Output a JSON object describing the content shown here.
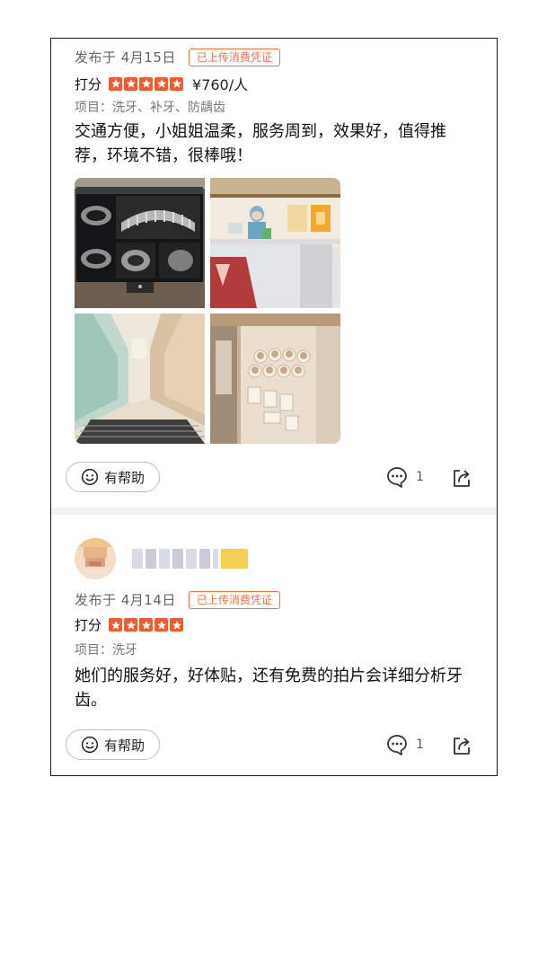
{
  "reviews": [
    {
      "date": "发布于 4月15日",
      "badge": "已上传消费凭证",
      "rating_label": "打分",
      "stars": 5,
      "price": "¥760/人",
      "project": "项目：洗牙、补牙、防龋齿",
      "text": "交通方便，小姐姐温柔，服务周到，效果好，值得推荐，环境不错，很棒哦！",
      "photos": [
        "dental-ct-scan",
        "clinic-reception",
        "clinic-hallway",
        "doctor-wall"
      ],
      "helpful_label": "有帮助",
      "comment_count": "1"
    },
    {
      "date": "发布于 4月14日",
      "badge": "已上传消费凭证",
      "rating_label": "打分",
      "stars": 5,
      "project": "项目：洗牙",
      "text": "她们的服务好，好体贴，还有免费的拍片会详细分析牙齿。",
      "helpful_label": "有帮助",
      "comment_count": "1"
    }
  ],
  "colors": {
    "accent": "#f35a2c",
    "badge": "#f0744b",
    "divider": "#f2f2f2"
  }
}
